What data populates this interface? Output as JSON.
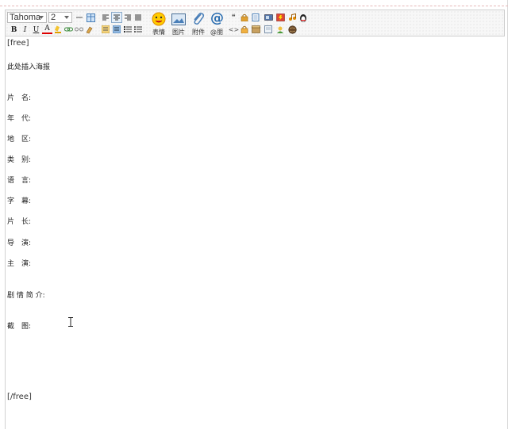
{
  "toolbar": {
    "font_family": "Tahoma",
    "font_size": "2",
    "buttons": {
      "bold": "B",
      "italic": "I",
      "underline": "U",
      "font_color": "A"
    },
    "big_buttons": {
      "emoji_label": "表情",
      "image_label": "图片",
      "attach_label": "附件",
      "mention_label": "@朋",
      "mention_glyph": "@"
    },
    "quote_glyph": "❝",
    "code_glyph": "<>"
  },
  "content": {
    "open_tag": "[free]",
    "poster_note": "此处插入海报",
    "fields": [
      "片　名:",
      "年　代:",
      "地　区:",
      "类　别:",
      "语　言:",
      "字　幕:",
      "片　长:",
      "导　演:",
      "主　演:"
    ],
    "synopsis": "剧 情 简 介:",
    "screenshots": "截　图:",
    "close_tag": "[/free]"
  }
}
